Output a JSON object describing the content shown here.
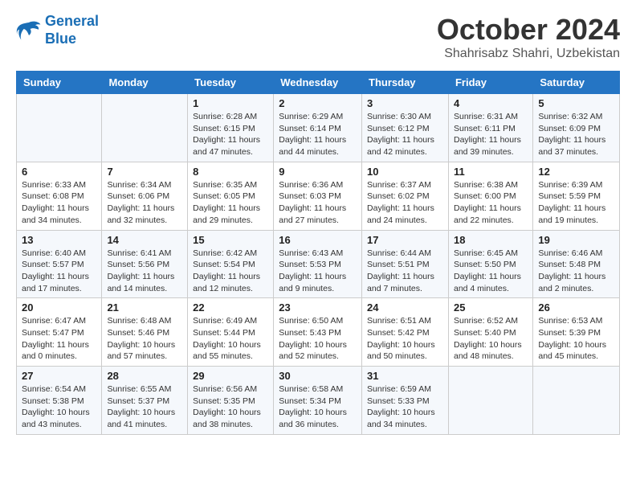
{
  "header": {
    "logo_line1": "General",
    "logo_line2": "Blue",
    "month": "October 2024",
    "location": "Shahrisabz Shahri, Uzbekistan"
  },
  "weekdays": [
    "Sunday",
    "Monday",
    "Tuesday",
    "Wednesday",
    "Thursday",
    "Friday",
    "Saturday"
  ],
  "weeks": [
    [
      {
        "day": "",
        "info": ""
      },
      {
        "day": "",
        "info": ""
      },
      {
        "day": "1",
        "info": "Sunrise: 6:28 AM\nSunset: 6:15 PM\nDaylight: 11 hours and 47 minutes."
      },
      {
        "day": "2",
        "info": "Sunrise: 6:29 AM\nSunset: 6:14 PM\nDaylight: 11 hours and 44 minutes."
      },
      {
        "day": "3",
        "info": "Sunrise: 6:30 AM\nSunset: 6:12 PM\nDaylight: 11 hours and 42 minutes."
      },
      {
        "day": "4",
        "info": "Sunrise: 6:31 AM\nSunset: 6:11 PM\nDaylight: 11 hours and 39 minutes."
      },
      {
        "day": "5",
        "info": "Sunrise: 6:32 AM\nSunset: 6:09 PM\nDaylight: 11 hours and 37 minutes."
      }
    ],
    [
      {
        "day": "6",
        "info": "Sunrise: 6:33 AM\nSunset: 6:08 PM\nDaylight: 11 hours and 34 minutes."
      },
      {
        "day": "7",
        "info": "Sunrise: 6:34 AM\nSunset: 6:06 PM\nDaylight: 11 hours and 32 minutes."
      },
      {
        "day": "8",
        "info": "Sunrise: 6:35 AM\nSunset: 6:05 PM\nDaylight: 11 hours and 29 minutes."
      },
      {
        "day": "9",
        "info": "Sunrise: 6:36 AM\nSunset: 6:03 PM\nDaylight: 11 hours and 27 minutes."
      },
      {
        "day": "10",
        "info": "Sunrise: 6:37 AM\nSunset: 6:02 PM\nDaylight: 11 hours and 24 minutes."
      },
      {
        "day": "11",
        "info": "Sunrise: 6:38 AM\nSunset: 6:00 PM\nDaylight: 11 hours and 22 minutes."
      },
      {
        "day": "12",
        "info": "Sunrise: 6:39 AM\nSunset: 5:59 PM\nDaylight: 11 hours and 19 minutes."
      }
    ],
    [
      {
        "day": "13",
        "info": "Sunrise: 6:40 AM\nSunset: 5:57 PM\nDaylight: 11 hours and 17 minutes."
      },
      {
        "day": "14",
        "info": "Sunrise: 6:41 AM\nSunset: 5:56 PM\nDaylight: 11 hours and 14 minutes."
      },
      {
        "day": "15",
        "info": "Sunrise: 6:42 AM\nSunset: 5:54 PM\nDaylight: 11 hours and 12 minutes."
      },
      {
        "day": "16",
        "info": "Sunrise: 6:43 AM\nSunset: 5:53 PM\nDaylight: 11 hours and 9 minutes."
      },
      {
        "day": "17",
        "info": "Sunrise: 6:44 AM\nSunset: 5:51 PM\nDaylight: 11 hours and 7 minutes."
      },
      {
        "day": "18",
        "info": "Sunrise: 6:45 AM\nSunset: 5:50 PM\nDaylight: 11 hours and 4 minutes."
      },
      {
        "day": "19",
        "info": "Sunrise: 6:46 AM\nSunset: 5:48 PM\nDaylight: 11 hours and 2 minutes."
      }
    ],
    [
      {
        "day": "20",
        "info": "Sunrise: 6:47 AM\nSunset: 5:47 PM\nDaylight: 11 hours and 0 minutes."
      },
      {
        "day": "21",
        "info": "Sunrise: 6:48 AM\nSunset: 5:46 PM\nDaylight: 10 hours and 57 minutes."
      },
      {
        "day": "22",
        "info": "Sunrise: 6:49 AM\nSunset: 5:44 PM\nDaylight: 10 hours and 55 minutes."
      },
      {
        "day": "23",
        "info": "Sunrise: 6:50 AM\nSunset: 5:43 PM\nDaylight: 10 hours and 52 minutes."
      },
      {
        "day": "24",
        "info": "Sunrise: 6:51 AM\nSunset: 5:42 PM\nDaylight: 10 hours and 50 minutes."
      },
      {
        "day": "25",
        "info": "Sunrise: 6:52 AM\nSunset: 5:40 PM\nDaylight: 10 hours and 48 minutes."
      },
      {
        "day": "26",
        "info": "Sunrise: 6:53 AM\nSunset: 5:39 PM\nDaylight: 10 hours and 45 minutes."
      }
    ],
    [
      {
        "day": "27",
        "info": "Sunrise: 6:54 AM\nSunset: 5:38 PM\nDaylight: 10 hours and 43 minutes."
      },
      {
        "day": "28",
        "info": "Sunrise: 6:55 AM\nSunset: 5:37 PM\nDaylight: 10 hours and 41 minutes."
      },
      {
        "day": "29",
        "info": "Sunrise: 6:56 AM\nSunset: 5:35 PM\nDaylight: 10 hours and 38 minutes."
      },
      {
        "day": "30",
        "info": "Sunrise: 6:58 AM\nSunset: 5:34 PM\nDaylight: 10 hours and 36 minutes."
      },
      {
        "day": "31",
        "info": "Sunrise: 6:59 AM\nSunset: 5:33 PM\nDaylight: 10 hours and 34 minutes."
      },
      {
        "day": "",
        "info": ""
      },
      {
        "day": "",
        "info": ""
      }
    ]
  ]
}
